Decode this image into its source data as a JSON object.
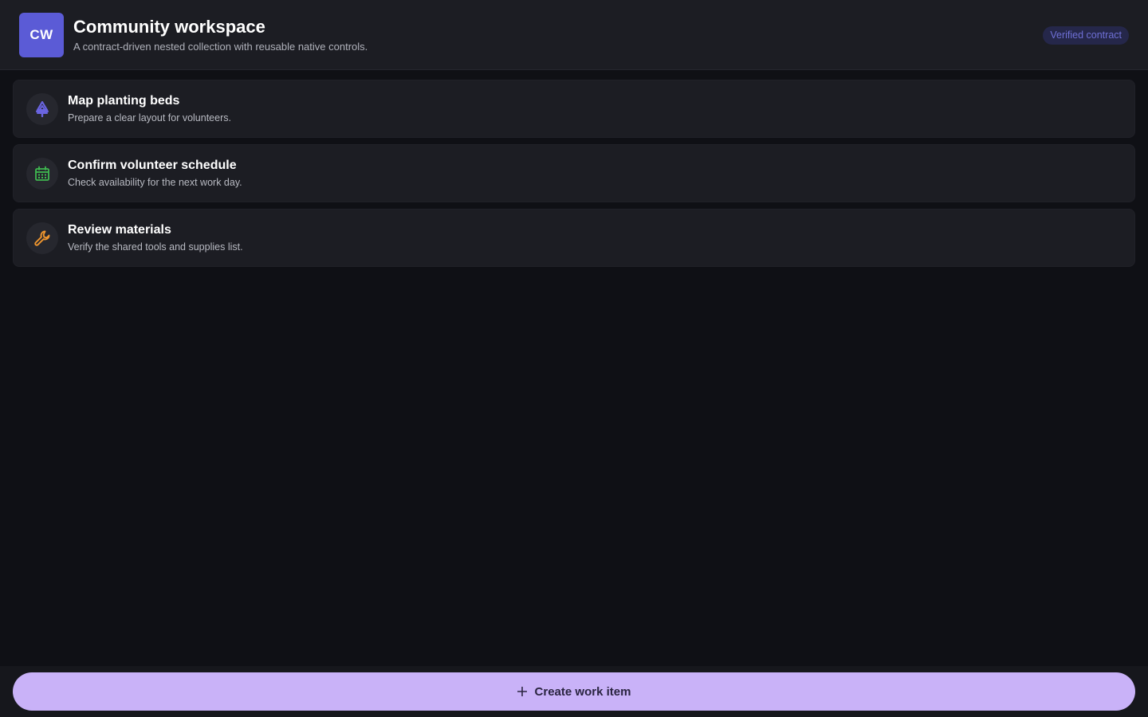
{
  "header": {
    "logo_text": "CW",
    "title": "Community workspace",
    "subtitle": "A contract-driven nested collection with reusable native controls.",
    "badge": "Verified contract"
  },
  "items": [
    {
      "title": "Map planting beds",
      "description": "Prepare a clear layout for volunteers.",
      "icon": "tree-icon",
      "icon_color": "#6a64e0"
    },
    {
      "title": "Confirm volunteer schedule",
      "description": "Check availability for the next work day.",
      "icon": "calendar-icon",
      "icon_color": "#3fb950"
    },
    {
      "title": "Review materials",
      "description": "Verify the shared tools and supplies list.",
      "icon": "wrench-icon",
      "icon_color": "#f0962e"
    }
  ],
  "footer": {
    "create_label": "Create work item",
    "create_icon": "plus-icon"
  },
  "colors": {
    "accent": "#5b5bd6",
    "button": "#c9b2f8",
    "background": "#0f1015",
    "surface": "#1c1d23"
  }
}
